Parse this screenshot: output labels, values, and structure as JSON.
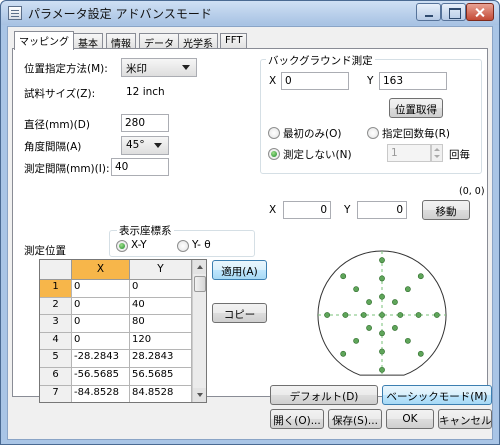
{
  "window": {
    "title": "パラメータ設定 アドバンスモード"
  },
  "tabs": [
    {
      "label": "マッピング",
      "active": true
    },
    {
      "label": "基本"
    },
    {
      "label": "情報"
    },
    {
      "label": "データ"
    },
    {
      "label": "光学系"
    },
    {
      "label": "FFT"
    }
  ],
  "mapping": {
    "position_method_label": "位置指定方法(M):",
    "position_method_value": "米印",
    "sample_size_label": "試料サイズ(Z):",
    "sample_size_value": "12 inch",
    "diameter_label": "直径(mm)(D)",
    "diameter_value": "280",
    "angle_label": "角度間隔(A)",
    "angle_value": "45°",
    "interval_label": "測定間隔(mm)(I):",
    "interval_value": "40"
  },
  "background": {
    "group_title": "バックグラウンド測定",
    "x_label": "X",
    "x_value": "0",
    "y_label": "Y",
    "y_value": "163",
    "get_position_label": "位置取得",
    "first_only_label": "最初のみ(O)",
    "every_n_label": "指定回数毎(R)",
    "no_measure_label": "測定しない(N)",
    "selected": "no_measure",
    "count_value": "1",
    "count_suffix": "回毎"
  },
  "move": {
    "origin_label": "(0, 0)",
    "x_label": "X",
    "x_value": "0",
    "y_label": "Y",
    "y_value": "0",
    "button_label": "移動"
  },
  "coords": {
    "group_title": "表示座標系",
    "xy_label": "X-Y",
    "yt_label": "Y- θ",
    "selected": "xy"
  },
  "measure": {
    "label": "測定位置",
    "apply_label": "適用(A)",
    "copy_label": "コピー",
    "columns": [
      "X",
      "Y"
    ],
    "rows": [
      {
        "n": "1",
        "x": "0",
        "y": "0"
      },
      {
        "n": "2",
        "x": "0",
        "y": "40"
      },
      {
        "n": "3",
        "x": "0",
        "y": "80"
      },
      {
        "n": "4",
        "x": "0",
        "y": "120"
      },
      {
        "n": "5",
        "x": "-28.2843",
        "y": "28.2843"
      },
      {
        "n": "6",
        "x": "-56.5685",
        "y": "56.5685"
      },
      {
        "n": "7",
        "x": "-84.8528",
        "y": "84.8528"
      }
    ]
  },
  "wafer": {
    "point_color": "#5fa55a",
    "outline_color": "#333333",
    "axis_color": "#7ac17a",
    "radius_mm": 140,
    "ring_radii_mm": [
      40,
      80,
      120
    ],
    "angles_deg": [
      0,
      45,
      90,
      135,
      180,
      225,
      270,
      315
    ]
  },
  "footer": {
    "default_label": "デフォルト(D)",
    "basic_mode_label": "ベーシックモード(M)",
    "open_label": "開く(O)...",
    "save_label": "保存(S)...",
    "ok_label": "OK",
    "cancel_label": "キャンセル"
  }
}
